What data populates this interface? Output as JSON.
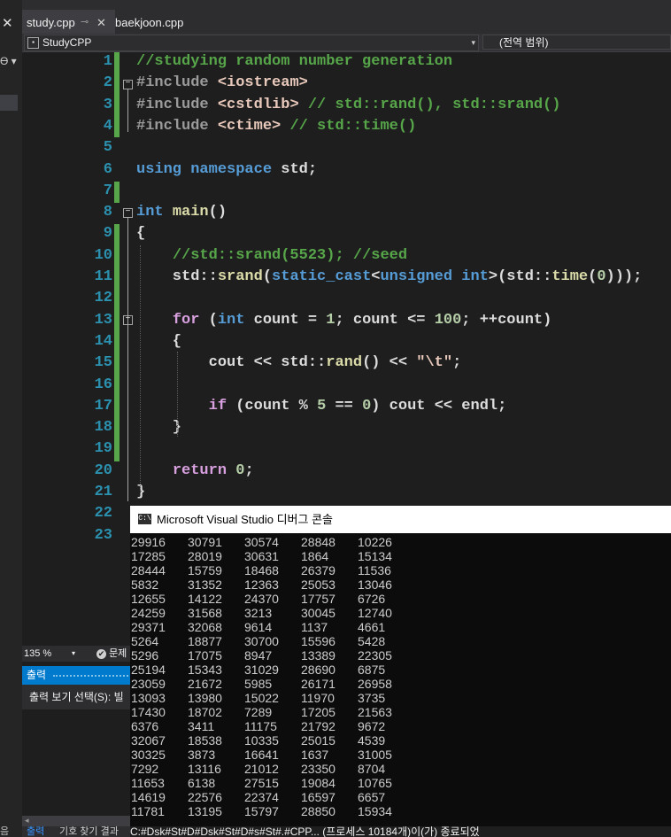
{
  "left_strip": {
    "close_glyph": "✕",
    "mark_text": "Ɵ ▾",
    "bottom_text": "음"
  },
  "tabs": [
    {
      "label": "study.cpp",
      "pin": "⊸",
      "close": "✕",
      "active": true
    },
    {
      "label": "baekjoon.cpp",
      "active": false
    }
  ],
  "navbar": {
    "project": "StudyCPP",
    "project_icon": "project-icon",
    "dropdown_arrow": "▾",
    "scope": "(전역 범위)"
  },
  "editor": {
    "line_numbers": [
      "1",
      "2",
      "3",
      "4",
      "5",
      "6",
      "7",
      "8",
      "9",
      "10",
      "11",
      "12",
      "13",
      "14",
      "15",
      "16",
      "17",
      "18",
      "19",
      "20",
      "21",
      "22",
      "23"
    ],
    "fold_glyph": "−",
    "lines": [
      [
        [
          "c-com",
          "//studying random number generation"
        ]
      ],
      [
        [
          "c-pp",
          "#include "
        ],
        [
          "c-inc",
          "<iostream>"
        ]
      ],
      [
        [
          "c-pp",
          "#include "
        ],
        [
          "c-inc",
          "<cstdlib>"
        ],
        [
          "c-com",
          " // std::rand(), std::srand()"
        ]
      ],
      [
        [
          "c-pp",
          "#include "
        ],
        [
          "c-inc",
          "<ctime>"
        ],
        [
          "c-com",
          " // std::time()"
        ]
      ],
      [],
      [
        [
          "c-kw",
          "using"
        ],
        [
          "c-txt",
          " "
        ],
        [
          "c-kw",
          "namespace"
        ],
        [
          "c-txt",
          " std;"
        ]
      ],
      [],
      [
        [
          "c-kw",
          "int"
        ],
        [
          "c-txt",
          " "
        ],
        [
          "c-fn",
          "main"
        ],
        [
          "c-txt",
          "()"
        ]
      ],
      [
        [
          "c-txt",
          "{"
        ]
      ],
      [
        [
          "c-txt",
          "    "
        ],
        [
          "c-com",
          "//std::srand(5523); //seed"
        ]
      ],
      [
        [
          "c-txt",
          "    std::"
        ],
        [
          "c-fn",
          "srand"
        ],
        [
          "c-txt",
          "("
        ],
        [
          "c-kw",
          "static_cast"
        ],
        [
          "c-txt",
          "<"
        ],
        [
          "c-kw",
          "unsigned int"
        ],
        [
          "c-txt",
          ">(std::"
        ],
        [
          "c-fn",
          "time"
        ],
        [
          "c-txt",
          "("
        ],
        [
          "c-num",
          "0"
        ],
        [
          "c-txt",
          ")));"
        ]
      ],
      [],
      [
        [
          "c-txt",
          "    "
        ],
        [
          "c-ctl",
          "for"
        ],
        [
          "c-txt",
          " ("
        ],
        [
          "c-kw",
          "int"
        ],
        [
          "c-txt",
          " count = "
        ],
        [
          "c-num",
          "1"
        ],
        [
          "c-txt",
          "; count <= "
        ],
        [
          "c-num",
          "100"
        ],
        [
          "c-txt",
          "; ++count)"
        ]
      ],
      [
        [
          "c-txt",
          "    {"
        ]
      ],
      [
        [
          "c-txt",
          "        cout << std::"
        ],
        [
          "c-fn",
          "rand"
        ],
        [
          "c-txt",
          "() << "
        ],
        [
          "c-str",
          "\""
        ],
        [
          "c-esc",
          "\\t"
        ],
        [
          "c-str",
          "\""
        ],
        [
          "c-txt",
          ";"
        ]
      ],
      [],
      [
        [
          "c-txt",
          "        "
        ],
        [
          "c-ctl",
          "if"
        ],
        [
          "c-txt",
          " (count % "
        ],
        [
          "c-num",
          "5"
        ],
        [
          "c-txt",
          " == "
        ],
        [
          "c-num",
          "0"
        ],
        [
          "c-txt",
          ") cout << endl;"
        ]
      ],
      [
        [
          "c-txt",
          "    }"
        ]
      ],
      [],
      [
        [
          "c-txt",
          "    "
        ],
        [
          "c-ctl",
          "return"
        ],
        [
          "c-txt",
          " "
        ],
        [
          "c-num",
          "0"
        ],
        [
          "c-txt",
          ";"
        ]
      ],
      [
        [
          "c-txt",
          "}"
        ]
      ],
      [],
      []
    ]
  },
  "status": {
    "zoom": "135 %",
    "zoom_arrow": "▾",
    "issues_icon": "✔",
    "issues_label": "문제"
  },
  "output_panel": {
    "header": "출력",
    "show_output_from": "출력 보기 선택(S):",
    "select_value": "빌",
    "scroll_left": "◂",
    "path_text": "C:#Dsk#St#D#Dsk#St#D#s#St#.#CPP... (프로세스 10184개)이(가) 종료되었",
    "tab_output": "출력",
    "tab_find_symbol": "기호 찾기 결과"
  },
  "console": {
    "icon_label": "C:\\",
    "title": "Microsoft Visual Studio 디버그 콘솔",
    "rows": [
      [
        "29916",
        "30791",
        "30574",
        "28848",
        "10226"
      ],
      [
        "17285",
        "28019",
        "30631",
        "1864",
        "15134"
      ],
      [
        "28444",
        "15759",
        "18468",
        "26379",
        "11536"
      ],
      [
        "5832",
        "31352",
        "12363",
        "25053",
        "13046"
      ],
      [
        "12655",
        "14122",
        "24370",
        "17757",
        "6726"
      ],
      [
        "24259",
        "31568",
        "3213",
        "30045",
        "12740"
      ],
      [
        "29371",
        "32068",
        "9614",
        "1137",
        "4661"
      ],
      [
        "5264",
        "18877",
        "30700",
        "15596",
        "5428"
      ],
      [
        "5296",
        "17075",
        "8947",
        "13389",
        "22305"
      ],
      [
        "25194",
        "15343",
        "31029",
        "28690",
        "6875"
      ],
      [
        "23059",
        "21672",
        "5985",
        "26171",
        "26958"
      ],
      [
        "13093",
        "13980",
        "15022",
        "11970",
        "3735"
      ],
      [
        "17430",
        "18702",
        "7289",
        "17205",
        "21563"
      ],
      [
        "6376",
        "3411",
        "11175",
        "21792",
        "9672"
      ],
      [
        "32067",
        "18538",
        "10335",
        "25015",
        "4539"
      ],
      [
        "30325",
        "3873",
        "16641",
        "1637",
        "31005"
      ],
      [
        "7292",
        "13116",
        "21012",
        "23350",
        "8704"
      ],
      [
        "11653",
        "6138",
        "27515",
        "19084",
        "10765"
      ],
      [
        "14619",
        "22576",
        "22374",
        "16597",
        "6657"
      ],
      [
        "11781",
        "13195",
        "15797",
        "28850",
        "15934"
      ]
    ]
  }
}
